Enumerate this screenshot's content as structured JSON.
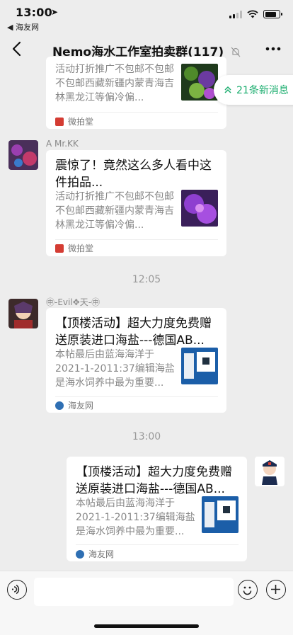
{
  "status_bar": {
    "time": "13:00",
    "back_app": "◀ 海友网"
  },
  "nav": {
    "title": "Nemo海水工作室拍卖群(117)"
  },
  "new_messages": "21条新消息",
  "messages": [
    {
      "desc": "活动打折推广不包邮不包邮不包邮西藏新疆内蒙青海吉林黑龙江等偏冷偏...",
      "source": "微拍堂"
    },
    {
      "sender": "A  Mr.KK",
      "title": "震惊了！竟然这么多人看中这件拍品...",
      "desc": "活动打折推广不包邮不包邮不包邮西藏新疆内蒙青海吉林黑龙江等偏冷偏...",
      "source": "微拍堂"
    },
    {
      "timestamp": "12:05",
      "sender": "㊥-Evil✥天-㊥",
      "title": "【顶楼活动】超大力度免费赠送原装进口海盐---德国AB...",
      "desc": "本帖最后由蓝海海洋于2021-1-2011:37编辑海盐是海水饲养中最为重要...",
      "source": "海友网"
    },
    {
      "timestamp": "13:00",
      "title": "【顶楼活动】超大力度免费赠送原装进口海盐---德国AB...",
      "desc": "本帖最后由蓝海海洋于2021-1-2011:37编辑海盐是海水饲养中最为重要...",
      "source": "海友网"
    }
  ],
  "colors": {
    "accent_green": "#1aad6e",
    "weipaitang_red": "#d43c33",
    "haiyou_blue": "#2f6fb3"
  },
  "icons": [
    "location-arrow-icon",
    "signal-icon",
    "wifi-icon",
    "battery-icon",
    "back-chevron-icon",
    "mute-bell-icon",
    "more-dots-icon",
    "double-chevron-up-icon",
    "voice-icon",
    "emoji-icon",
    "plus-icon"
  ]
}
